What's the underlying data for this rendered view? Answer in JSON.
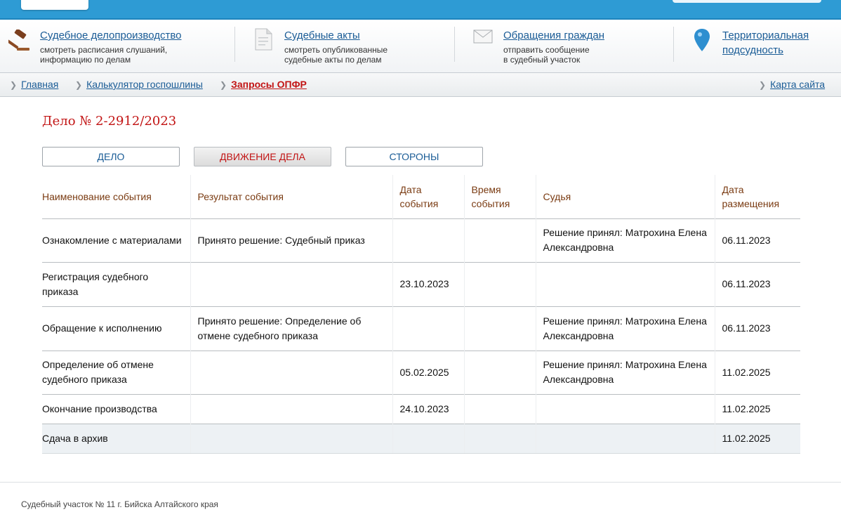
{
  "services": [
    {
      "icon": "gavel-icon",
      "title": "Судебное делопроизводство",
      "desc1": "смотреть расписания слушаний,",
      "desc2": "информацию по делам"
    },
    {
      "icon": "document-icon",
      "title": "Судебные акты",
      "desc1": "смотреть опубликованные",
      "desc2": "судебные акты по делам"
    },
    {
      "icon": "envelope-icon",
      "title": "Обращения граждан",
      "desc1": "отправить сообщение",
      "desc2": "в судебный участок"
    },
    {
      "icon": "map-pin-icon",
      "title1": "Территориальная",
      "title2": "подсудность"
    }
  ],
  "breadcrumbs": {
    "home": "Главная",
    "calculator": "Калькулятор госпошлины",
    "current": "Запросы ОПФР",
    "sitemap": "Карта сайта"
  },
  "case": {
    "title": "Дело № 2-2912/2023"
  },
  "tabs": [
    {
      "label": "ДЕЛО"
    },
    {
      "label": "ДВИЖЕНИЕ ДЕЛА",
      "active": true
    },
    {
      "label": "СТОРОНЫ"
    }
  ],
  "table": {
    "headers": [
      {
        "l1": "Наименование события",
        "l2": ""
      },
      {
        "l1": "Результат события",
        "l2": ""
      },
      {
        "l1": "Дата",
        "l2": "события"
      },
      {
        "l1": "Время",
        "l2": "события"
      },
      {
        "l1": "Судья",
        "l2": ""
      },
      {
        "l1": "Дата",
        "l2": "размещения"
      }
    ],
    "rows": [
      {
        "event": "Ознакомление с материалами",
        "result": "Принято решение: Судебный приказ",
        "date": "",
        "time": "",
        "judge": "Решение принял: Матрохина Елена Александровна",
        "posted": "06.11.2023"
      },
      {
        "event": "Регистрация судебного приказа",
        "result": "",
        "date": "23.10.2023",
        "time": "",
        "judge": "",
        "posted": "06.11.2023"
      },
      {
        "event": "Обращение к исполнению",
        "result": "Принято решение: Определение об отмене судебного приказа",
        "date": "",
        "time": "",
        "judge": "Решение принял: Матрохина Елена Александровна",
        "posted": "06.11.2023"
      },
      {
        "event": "Определение об отмене судебного приказа",
        "result": "",
        "date": "05.02.2025",
        "time": "",
        "judge": "Решение принял: Матрохина Елена Александровна",
        "posted": "11.02.2025"
      },
      {
        "event": "Окончание производства",
        "result": "",
        "date": "24.10.2023",
        "time": "",
        "judge": "",
        "posted": "11.02.2025"
      },
      {
        "event": "Сдача в архив",
        "result": "",
        "date": "",
        "time": "",
        "judge": "",
        "posted": "11.02.2025"
      }
    ]
  },
  "footer": {
    "text": "Судебный участок № 11 г. Бийска Алтайского края"
  },
  "colors": {
    "brand": "#2e9bd4",
    "link": "#1a5c96",
    "accent": "#c21414",
    "header_text": "#7a3b12"
  }
}
